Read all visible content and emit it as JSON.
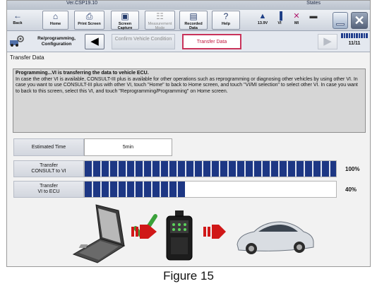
{
  "window": {
    "version": "Ver.CSP19.10",
    "status_label": "States"
  },
  "toolbar": {
    "buttons": [
      {
        "label": "Back",
        "icon": "back-arrow-icon",
        "glyph": "←"
      },
      {
        "label": "Home",
        "icon": "home-icon",
        "glyph": "⌂"
      },
      {
        "label": "Print Screen",
        "icon": "printer-icon",
        "glyph": "⎙"
      },
      {
        "label": "Screen Capture",
        "icon": "camera-icon",
        "glyph": "▣"
      },
      {
        "label": "Measurement Mode",
        "icon": "measurement-icon",
        "glyph": "☷"
      },
      {
        "label": "Recorded Data",
        "icon": "recorded-data-icon",
        "glyph": "▤"
      },
      {
        "label": "Help",
        "icon": "help-icon",
        "glyph": "?"
      }
    ],
    "status": [
      {
        "label": "13.9V",
        "icon": "car-battery-icon",
        "glyph": "▲"
      },
      {
        "label": "VI",
        "icon": "signal-icon",
        "glyph": "▐"
      },
      {
        "label": "MI",
        "icon": "mi-disconnected-icon",
        "glyph": "✕"
      },
      {
        "label": "",
        "icon": "connector-icon",
        "glyph": "▬"
      }
    ]
  },
  "breadcrumb": {
    "home_label": "Re/programming, Configuration",
    "steps": [
      "Confirm Vehicle Condition",
      "Transfer Data"
    ],
    "page": "11/11",
    "page_total": 11
  },
  "section_title": "Transfer Data",
  "message": {
    "line1": "Programming...VI is transferring the data to vehicle ECU.",
    "body": "In case the other VI is available, CONSULT-III plus is available for other operations such as reprogramming or diagnosing other vehicles by using other VI. In case you want to use CONSULT-III plus with other VI, touch \"Home\" to back to Home screen, and touch \"VI/MI selection\" to select other VI. In case you want to back to this screen, select this VI, and touch \"Reprogramming/Programming\" on Home screen."
  },
  "estimated": {
    "label": "Estimated Time",
    "value": "5min"
  },
  "transfers": [
    {
      "label": "Transfer CONSULT to VI",
      "line1": "Transfer",
      "line2": "CONSULT to VI",
      "percent_text": "100%",
      "progress": 100
    },
    {
      "label": "Transfer VI to ECU",
      "line1": "Transfer",
      "line2": "VI to ECU",
      "percent_text": "40%",
      "progress": 40
    }
  ],
  "colors": {
    "progress_fill": "#1d3784",
    "active_step": "#c9335a",
    "check": "#3aa13a",
    "arrow_red": "#d01818"
  },
  "caption": "Figure 15"
}
